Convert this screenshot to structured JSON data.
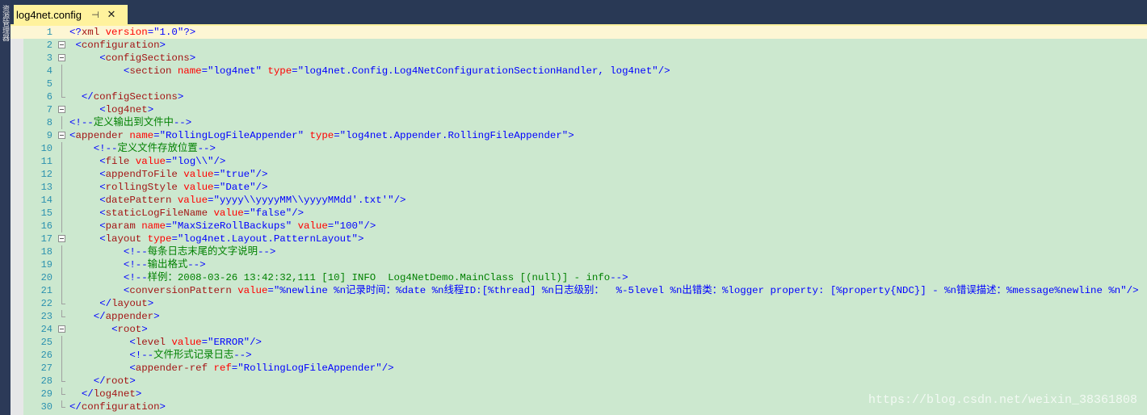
{
  "side_panel": {
    "vertical_text": "资源管理器"
  },
  "tab": {
    "label": "log4net.config",
    "pin_glyph": "⊣",
    "close_glyph": "✕"
  },
  "colors": {
    "editor_background": "#cce8cf",
    "tab_active": "#fff29d",
    "frame": "#293955",
    "line_number": "#2b91af",
    "tag": "#a31515",
    "attribute": "#ff0000",
    "value": "#0000ff",
    "comment": "#008000"
  },
  "code_lines": [
    {
      "n": "1",
      "fold": "none",
      "indent": "",
      "tokens": [
        [
          "b",
          "<?"
        ],
        [
          "t",
          "xml"
        ],
        [
          "a",
          " version"
        ],
        [
          "b",
          "="
        ],
        [
          "v",
          "\"1.0\""
        ],
        [
          "b",
          "?>"
        ]
      ]
    },
    {
      "n": "2",
      "fold": "box",
      "indent": " ",
      "tokens": [
        [
          "b",
          "<"
        ],
        [
          "t",
          "configuration"
        ],
        [
          "b",
          ">"
        ]
      ]
    },
    {
      "n": "3",
      "fold": "box",
      "indent": "     ",
      "tokens": [
        [
          "b",
          "<"
        ],
        [
          "t",
          "configSections"
        ],
        [
          "b",
          ">"
        ]
      ]
    },
    {
      "n": "4",
      "fold": "line",
      "indent": "         ",
      "tokens": [
        [
          "b",
          "<"
        ],
        [
          "t",
          "section"
        ],
        [
          "a",
          " name"
        ],
        [
          "b",
          "="
        ],
        [
          "v",
          "\"log4net\""
        ],
        [
          "a",
          " type"
        ],
        [
          "b",
          "="
        ],
        [
          "v",
          "\"log4net.Config.Log4NetConfigurationSectionHandler, log4net\""
        ],
        [
          "b",
          "/>"
        ]
      ]
    },
    {
      "n": "5",
      "fold": "line",
      "indent": "",
      "tokens": []
    },
    {
      "n": "6",
      "fold": "end",
      "indent": "  ",
      "tokens": [
        [
          "b",
          "</"
        ],
        [
          "t",
          "configSections"
        ],
        [
          "b",
          ">"
        ]
      ]
    },
    {
      "n": "7",
      "fold": "box",
      "indent": "     ",
      "tokens": [
        [
          "b",
          "<"
        ],
        [
          "t",
          "log4net"
        ],
        [
          "b",
          ">"
        ]
      ]
    },
    {
      "n": "8",
      "fold": "line",
      "indent": "",
      "tokens": [
        [
          "b",
          "<!--"
        ],
        [
          "c",
          "定义输出到文件中"
        ],
        [
          "b",
          "-->"
        ]
      ]
    },
    {
      "n": "9",
      "fold": "box",
      "indent": "",
      "tokens": [
        [
          "b",
          "<"
        ],
        [
          "t",
          "appender"
        ],
        [
          "a",
          " name"
        ],
        [
          "b",
          "="
        ],
        [
          "v",
          "\"RollingLogFileAppender\""
        ],
        [
          "a",
          " type"
        ],
        [
          "b",
          "="
        ],
        [
          "v",
          "\"log4net.Appender.RollingFileAppender\""
        ],
        [
          "b",
          ">"
        ]
      ]
    },
    {
      "n": "10",
      "fold": "line",
      "indent": "    ",
      "tokens": [
        [
          "b",
          "<!--"
        ],
        [
          "c",
          "定义文件存放位置"
        ],
        [
          "b",
          "-->"
        ]
      ]
    },
    {
      "n": "11",
      "fold": "line",
      "indent": "     ",
      "tokens": [
        [
          "b",
          "<"
        ],
        [
          "t",
          "file"
        ],
        [
          "a",
          " value"
        ],
        [
          "b",
          "="
        ],
        [
          "v",
          "\"log\\\\\""
        ],
        [
          "b",
          "/>"
        ]
      ]
    },
    {
      "n": "12",
      "fold": "line",
      "indent": "     ",
      "tokens": [
        [
          "b",
          "<"
        ],
        [
          "t",
          "appendToFile"
        ],
        [
          "a",
          " value"
        ],
        [
          "b",
          "="
        ],
        [
          "v",
          "\"true\""
        ],
        [
          "b",
          "/>"
        ]
      ]
    },
    {
      "n": "13",
      "fold": "line",
      "indent": "     ",
      "tokens": [
        [
          "b",
          "<"
        ],
        [
          "t",
          "rollingStyle"
        ],
        [
          "a",
          " value"
        ],
        [
          "b",
          "="
        ],
        [
          "v",
          "\"Date\""
        ],
        [
          "b",
          "/>"
        ]
      ]
    },
    {
      "n": "14",
      "fold": "line",
      "indent": "     ",
      "tokens": [
        [
          "b",
          "<"
        ],
        [
          "t",
          "datePattern"
        ],
        [
          "a",
          " value"
        ],
        [
          "b",
          "="
        ],
        [
          "v",
          "\"yyyy\\\\yyyyMM\\\\yyyyMMdd'.txt'\""
        ],
        [
          "b",
          "/>"
        ]
      ]
    },
    {
      "n": "15",
      "fold": "line",
      "indent": "     ",
      "tokens": [
        [
          "b",
          "<"
        ],
        [
          "t",
          "staticLogFileName"
        ],
        [
          "a",
          " value"
        ],
        [
          "b",
          "="
        ],
        [
          "v",
          "\"false\""
        ],
        [
          "b",
          "/>"
        ]
      ]
    },
    {
      "n": "16",
      "fold": "line",
      "indent": "     ",
      "tokens": [
        [
          "b",
          "<"
        ],
        [
          "t",
          "param"
        ],
        [
          "a",
          " name"
        ],
        [
          "b",
          "="
        ],
        [
          "v",
          "\"MaxSizeRollBackups\""
        ],
        [
          "a",
          " value"
        ],
        [
          "b",
          "="
        ],
        [
          "v",
          "\"100\""
        ],
        [
          "b",
          "/>"
        ]
      ]
    },
    {
      "n": "17",
      "fold": "box",
      "indent": "     ",
      "tokens": [
        [
          "b",
          "<"
        ],
        [
          "t",
          "layout"
        ],
        [
          "a",
          " type"
        ],
        [
          "b",
          "="
        ],
        [
          "v",
          "\"log4net.Layout.PatternLayout\""
        ],
        [
          "b",
          ">"
        ]
      ]
    },
    {
      "n": "18",
      "fold": "line",
      "indent": "         ",
      "tokens": [
        [
          "b",
          "<!--"
        ],
        [
          "c",
          "每条日志末尾的文字说明"
        ],
        [
          "b",
          "-->"
        ]
      ]
    },
    {
      "n": "19",
      "fold": "line",
      "indent": "         ",
      "tokens": [
        [
          "b",
          "<!--"
        ],
        [
          "c",
          "输出格式"
        ],
        [
          "b",
          "-->"
        ]
      ]
    },
    {
      "n": "20",
      "fold": "line",
      "indent": "         ",
      "tokens": [
        [
          "b",
          "<!--"
        ],
        [
          "c",
          "样例：2008-03-26 13:42:32,111 [10] INFO  Log4NetDemo.MainClass [(null)] - info"
        ],
        [
          "b",
          "-->"
        ]
      ]
    },
    {
      "n": "21",
      "fold": "line",
      "indent": "         ",
      "tokens": [
        [
          "b",
          "<"
        ],
        [
          "t",
          "conversionPattern"
        ],
        [
          "a",
          " value"
        ],
        [
          "b",
          "="
        ],
        [
          "v",
          "\"%newline %n记录时间：%date %n线程ID:[%thread] %n日志级别：  %-5level %n出错类：%logger property: [%property{NDC}] - %n错误描述：%message%newline %n\""
        ],
        [
          "b",
          "/>"
        ]
      ]
    },
    {
      "n": "22",
      "fold": "end",
      "indent": "     ",
      "tokens": [
        [
          "b",
          "</"
        ],
        [
          "t",
          "layout"
        ],
        [
          "b",
          ">"
        ]
      ]
    },
    {
      "n": "23",
      "fold": "end",
      "indent": "    ",
      "tokens": [
        [
          "b",
          "</"
        ],
        [
          "t",
          "appender"
        ],
        [
          "b",
          ">"
        ]
      ]
    },
    {
      "n": "24",
      "fold": "box",
      "indent": "       ",
      "tokens": [
        [
          "b",
          "<"
        ],
        [
          "t",
          "root"
        ],
        [
          "b",
          ">"
        ]
      ]
    },
    {
      "n": "25",
      "fold": "line",
      "indent": "          ",
      "tokens": [
        [
          "b",
          "<"
        ],
        [
          "t",
          "level"
        ],
        [
          "a",
          " value"
        ],
        [
          "b",
          "="
        ],
        [
          "v",
          "\"ERROR\""
        ],
        [
          "b",
          "/>"
        ]
      ]
    },
    {
      "n": "26",
      "fold": "line",
      "indent": "          ",
      "tokens": [
        [
          "b",
          "<!--"
        ],
        [
          "c",
          "文件形式记录日志"
        ],
        [
          "b",
          "-->"
        ]
      ]
    },
    {
      "n": "27",
      "fold": "line",
      "indent": "          ",
      "tokens": [
        [
          "b",
          "<"
        ],
        [
          "t",
          "appender-ref"
        ],
        [
          "a",
          " ref"
        ],
        [
          "b",
          "="
        ],
        [
          "v",
          "\"RollingLogFileAppender\""
        ],
        [
          "b",
          "/>"
        ]
      ]
    },
    {
      "n": "28",
      "fold": "end",
      "indent": "    ",
      "tokens": [
        [
          "b",
          "</"
        ],
        [
          "t",
          "root"
        ],
        [
          "b",
          ">"
        ]
      ]
    },
    {
      "n": "29",
      "fold": "end",
      "indent": "  ",
      "tokens": [
        [
          "b",
          "</"
        ],
        [
          "t",
          "log4net"
        ],
        [
          "b",
          ">"
        ]
      ]
    },
    {
      "n": "30",
      "fold": "end",
      "indent": "",
      "tokens": [
        [
          "b",
          "</"
        ],
        [
          "t",
          "configuration"
        ],
        [
          "b",
          ">"
        ]
      ]
    }
  ],
  "watermark": "https://blog.csdn.net/weixin_38361808"
}
